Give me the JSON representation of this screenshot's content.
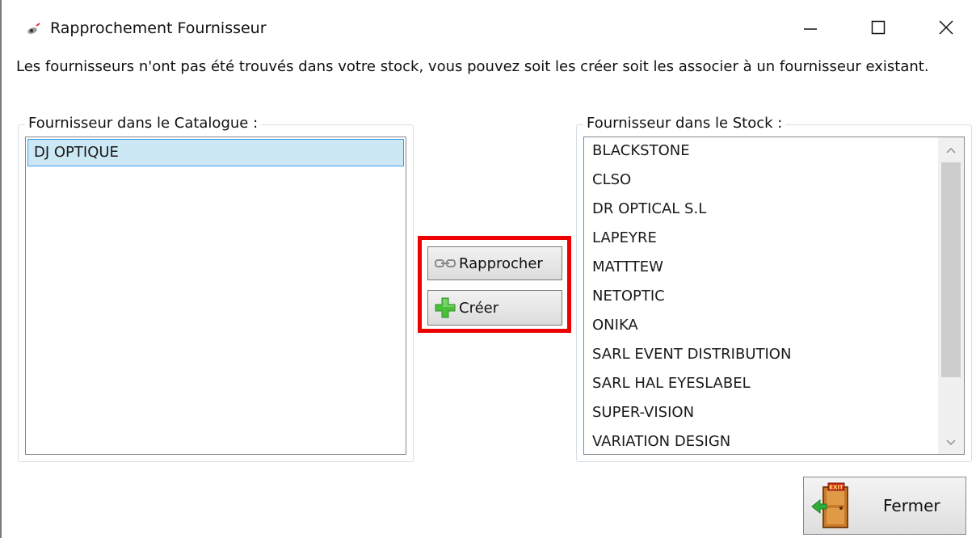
{
  "window": {
    "title": "Rapprochement Fournisseur",
    "icon": "app-logo-icon",
    "controls": [
      "minimize-icon",
      "maximize-icon",
      "close-icon"
    ]
  },
  "message": "Les fournisseurs n'ont pas été trouvés dans votre stock, vous pouvez soit les créer soit les associer à un fournisseur existant.",
  "catalogue": {
    "title": "Fournisseur dans le Catalogue :",
    "items": [
      {
        "label": "DJ OPTIQUE",
        "selected": true
      }
    ]
  },
  "stock": {
    "title": "Fournisseur dans le Stock :",
    "items": [
      "BLACKSTONE",
      "CLSO",
      "DR OPTICAL S.L",
      "LAPEYRE",
      "MATTTEW",
      "NETOPTIC",
      "ONIKA",
      "SARL EVENT DISTRIBUTION",
      "SARL HAL EYESLABEL",
      "SUPER-VISION",
      "VARIATION DESIGN"
    ]
  },
  "actions": {
    "rapprocher_label": "Rapprocher",
    "rapprocher_icon": "link-icon",
    "creer_label": "Créer",
    "creer_icon": "plus-icon",
    "highlight_color": "#ee0000"
  },
  "footer": {
    "fermer_label": "Fermer",
    "fermer_icon": "exit-door-icon",
    "exit_sign_text": "EXIT"
  },
  "colors": {
    "selection_bg": "#cce8f5",
    "selection_border": "#3d9ee6"
  }
}
